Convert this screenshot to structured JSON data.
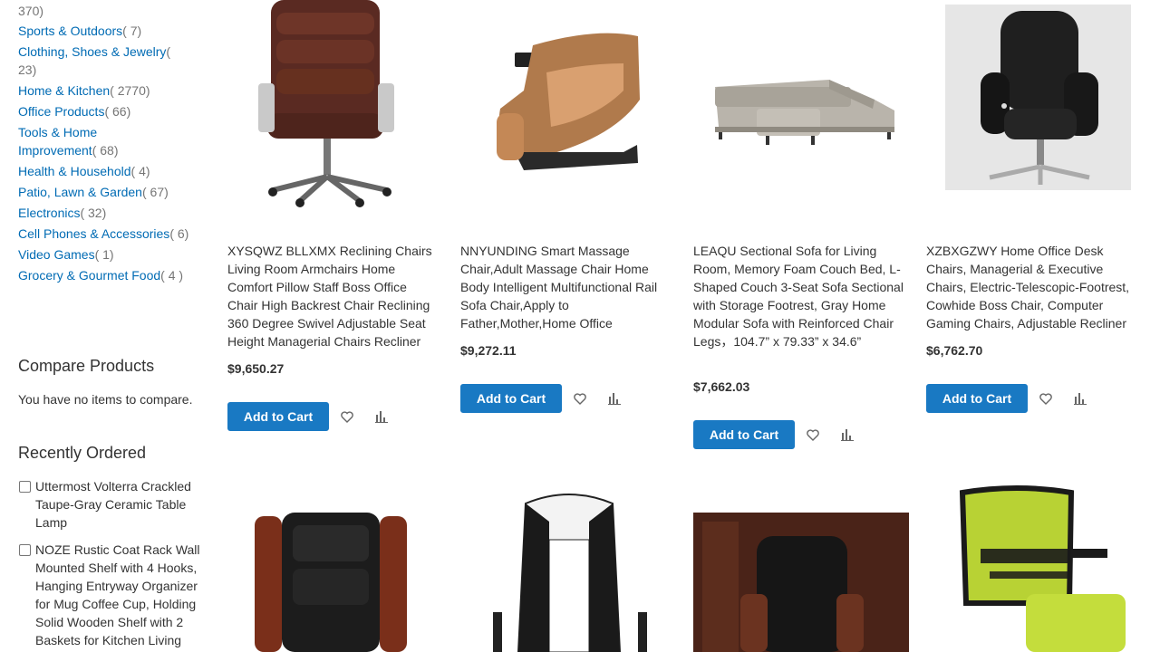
{
  "categories": {
    "partial_count": "370)",
    "items": [
      {
        "label": "Sports & Outdoors",
        "count": "( 7)"
      },
      {
        "label": "Clothing, Shoes & Jewelry",
        "count": "( 23)"
      },
      {
        "label": "Home & Kitchen",
        "count": "( 2770)"
      },
      {
        "label": "Office Products",
        "count": "( 66)"
      },
      {
        "label": "Tools & Home Improvement",
        "count": "( 68)"
      },
      {
        "label": "Health & Household",
        "count": "( 4)"
      },
      {
        "label": "Patio, Lawn & Garden",
        "count": "( 67)"
      },
      {
        "label": "Electronics",
        "count": "( 32)"
      },
      {
        "label": "Cell Phones & Accessories",
        "count": "( 6)"
      },
      {
        "label": "Video Games",
        "count": "( 1)"
      },
      {
        "label": "Grocery & Gourmet Food",
        "count": "( 4 )"
      }
    ]
  },
  "compare": {
    "title": "Compare Products",
    "empty_text": "You have no items to compare."
  },
  "recently_ordered": {
    "title": "Recently Ordered",
    "items": [
      {
        "text": "Uttermost Volterra Crackled Taupe-Gray Ceramic Table Lamp"
      },
      {
        "text": "NOZE Rustic Coat Rack Wall Mounted Shelf with 4 Hooks, Hanging Entryway Organizer for Mug Coffee Cup, Holding Solid Wooden Shelf with 2 Baskets for Kitchen Living"
      }
    ]
  },
  "ui": {
    "add_to_cart": "Add to Cart",
    "wishlist_icon": "heart-icon",
    "compare_icon": "bar-chart-icon",
    "accent_color": "#1979c3",
    "link_color": "#006bb4"
  },
  "products": [
    {
      "name": "XYSQWZ BLLXMX Reclining Chairs Living Room Armchairs Home Comfort Pillow Staff Boss Office Chair High Backrest Chair Reclining 360 Degree Swivel Adjustable Seat Height Managerial Chairs Recliner",
      "price": "$9,650.27",
      "image": "brown-leather-office-chair"
    },
    {
      "name": "NNYUNDING Smart Massage Chair,Adult Massage Chair Home Body Intelligent Multifunctional Rail Sofa Chair,Apply to Father,Mother,Home Office",
      "price": "$9,272.11",
      "image": "massage-chair"
    },
    {
      "name": "LEAQU Sectional Sofa for Living Room, Memory Foam Couch Bed, L-Shaped Couch 3-Seat Sofa Sectional with Storage Footrest, Gray Home Modular Sofa with Reinforced Chair Legs，104.7” x 79.33” x 34.6”",
      "price": "$7,662.03",
      "image": "gray-sectional-sofa"
    },
    {
      "name": "XZBXGZWY Home Office Desk Chairs, Managerial & Executive Chairs, Electric-Telescopic-Footrest, Cowhide Boss Chair, Computer Gaming Chairs, Adjustable Recliner",
      "price": "$6,762.70",
      "image": "black-executive-chair"
    },
    {
      "image": "carved-wood-leather-chair"
    },
    {
      "image": "white-gaming-chair"
    },
    {
      "image": "black-boss-chair"
    },
    {
      "image": "green-mesh-chair"
    }
  ]
}
